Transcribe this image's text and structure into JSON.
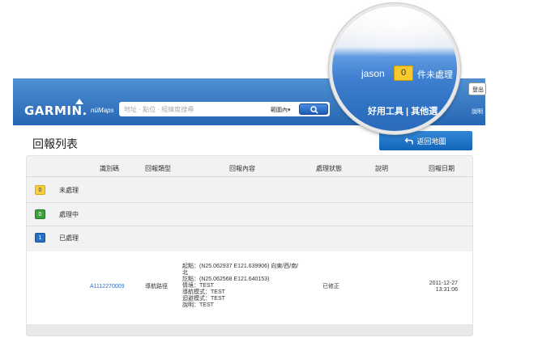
{
  "header": {
    "logo": "GARMIN.",
    "logo_sub": "nüMaps",
    "search_placeholder": "地址 · 點位 · 經緯度搜尋",
    "range_select": "範圍內▾",
    "logout": "登出",
    "help": "說明"
  },
  "magnifier": {
    "username": "jason",
    "pending_count": "0",
    "pending_label": "件未處理",
    "tools_label": "好用工具 | 其他選"
  },
  "page": {
    "title": "回報列表",
    "back_button": "返回地圖"
  },
  "table": {
    "columns": [
      "識別碼",
      "回報類型",
      "回報內容",
      "處理狀態",
      "說明",
      "回報日期"
    ],
    "status_rows": [
      {
        "count": "0",
        "label": "未處理",
        "color": "#f7cf3c"
      },
      {
        "count": "0",
        "label": "處理中",
        "color": "#39a339"
      },
      {
        "count": "1",
        "label": "已處理",
        "color": "#2470c2"
      }
    ],
    "rows": [
      {
        "id": "A1112270009",
        "type": "導航路徑",
        "content": [
          "起點：(N25.062937 E121.639906) 向東/西/南/",
          "北",
          "訖點：(N25.062568 E121.640153)",
          "情境：TEST",
          "導航模式：TEST",
          "迴避模式：TEST",
          "說明：TEST"
        ],
        "status": "已修正",
        "note": "",
        "date": "2011-12-27",
        "time": "13:31:06"
      }
    ]
  }
}
